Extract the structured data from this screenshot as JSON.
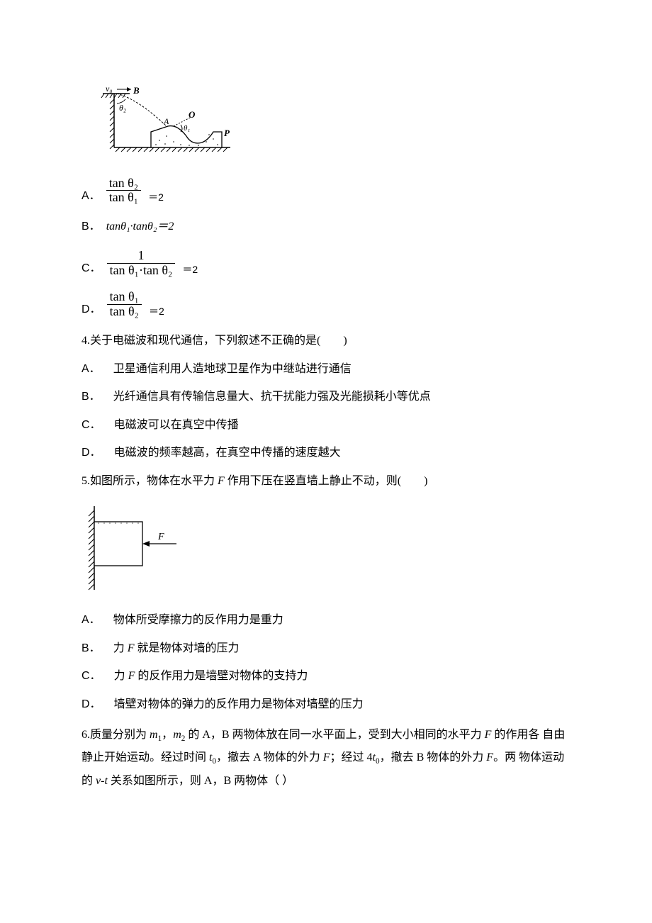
{
  "q3": {
    "optA_label": "A．",
    "optA_num": "tan θ₂",
    "optA_den": "tan θ₁",
    "optA_suffix": "＝2",
    "optB_label": "B．",
    "optB_text": "tanθ₁·tanθ₂＝2",
    "optC_label": "C．",
    "optC_num": "1",
    "optC_den": "tan θ₁·tan θ₂",
    "optC_suffix": "＝2",
    "optD_label": "D．",
    "optD_num": "tan θ₁",
    "optD_den": "tan θ₂",
    "optD_suffix": "＝2"
  },
  "q4": {
    "stem": "4.关于电磁波和现代通信，下列叙述不正确的是(　　)",
    "A_label": "A．",
    "A_text": "卫星通信利用人造地球卫星作为中继站进行通信",
    "B_label": "B．",
    "B_text": "光纤通信具有传输信息量大、抗干扰能力强及光能损耗小等优点",
    "C_label": "C．",
    "C_text": "电磁波可以在真空中传播",
    "D_label": "D．",
    "D_text": "电磁波的频率越高，在真空中传播的速度越大"
  },
  "q5": {
    "stem_prefix": "5.如图所示，物体在水平力 ",
    "stem_var": "F",
    "stem_suffix": " 作用下压在竖直墙上静止不动，则(　　)",
    "A_label": "A．",
    "A_text": "物体所受摩擦力的反作用力是重力",
    "B_label": "B．",
    "B_prefix": "力 ",
    "B_var": "F",
    "B_suffix": " 就是物体对墙的压力",
    "C_label": "C．",
    "C_prefix": "力 ",
    "C_var": "F",
    "C_suffix": " 的反作用力是墙壁对物体的支持力",
    "D_label": "D．",
    "D_text": "墙壁对物体的弹力的反作用力是物体对墙壁的压力"
  },
  "q6": {
    "line1_p1": "6.质量分别为 ",
    "line1_m1": "m",
    "line1_s1": "1",
    "line1_p2": "，",
    "line1_m2": "m",
    "line1_s2": "2",
    "line1_p3": " 的 A，B 两物体放在同一水平面上，受到大小相同的水平力 ",
    "line1_F": "F",
    "line1_p4": " 的作用各",
    "line2_p1": "自由静止开始运动。经过时间 ",
    "line2_t": "t",
    "line2_s0a": "0",
    "line2_p2": "，撤去 A 物体的外力 ",
    "line2_Fa": "F",
    "line2_p3": "；经过 4",
    "line2_tb": "t",
    "line2_s0b": "0",
    "line2_p4": "，撤去 B 物体的外力 ",
    "line2_Fb": "F",
    "line2_p5": "。两",
    "line3_p1": "物体运动的 ",
    "line3_vt": "v-t",
    "line3_p2": " 关系如图所示，则 A，B 两物体（  ）"
  },
  "fig1_labels": {
    "v0": "v₀",
    "B": "B",
    "theta2": "θ₂",
    "O": "O",
    "A": "A",
    "theta1": "θ₁",
    "P": "P"
  },
  "fig2_labels": {
    "F": "F"
  }
}
